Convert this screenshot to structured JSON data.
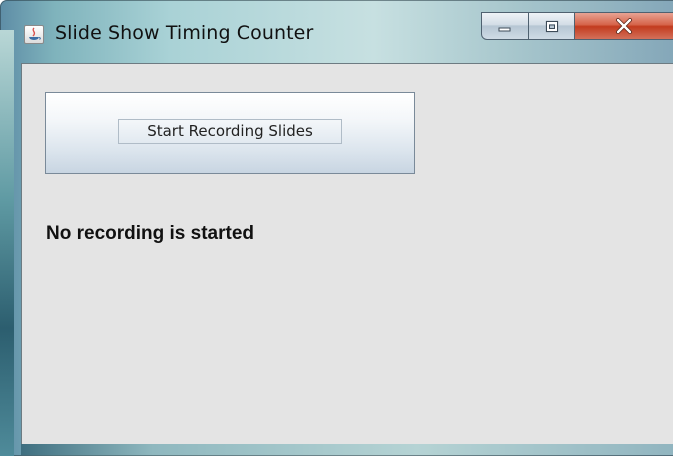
{
  "window": {
    "title": "Slide Show Timing Counter",
    "app_icon": "java-app-icon",
    "controls": {
      "minimize": "minimize-icon",
      "maximize": "maximize-icon",
      "close": "close-icon"
    }
  },
  "main": {
    "record_button_label": "Start Recording Slides",
    "status_text": "No recording is started"
  },
  "colors": {
    "client_bg": "#e4e4e4",
    "close_button": "#c23b1e"
  }
}
